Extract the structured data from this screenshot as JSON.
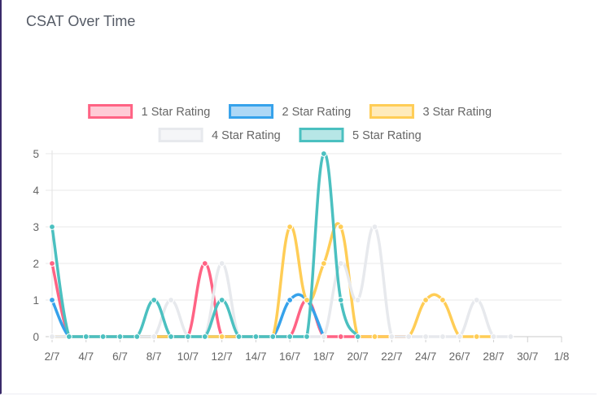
{
  "card": {
    "title": "CSAT Over Time"
  },
  "chart_data": {
    "type": "line",
    "title": "CSAT Over Time",
    "xlabel": "",
    "ylabel": "",
    "ylim": [
      0,
      5
    ],
    "grid": true,
    "legend_position": "top",
    "x": [
      "2/7",
      "3/7",
      "4/7",
      "5/7",
      "6/7",
      "7/7",
      "8/7",
      "9/7",
      "10/7",
      "11/7",
      "12/7",
      "13/7",
      "14/7",
      "15/7",
      "16/7",
      "17/7",
      "18/7",
      "19/7",
      "20/7",
      "21/7",
      "22/7",
      "23/7",
      "24/7",
      "25/7",
      "26/7",
      "27/7",
      "28/7",
      "29/7",
      "30/7",
      "31/7",
      "1/8"
    ],
    "x_tick_labels": [
      "2/7",
      "4/7",
      "6/7",
      "8/7",
      "10/7",
      "12/7",
      "14/7",
      "16/7",
      "18/7",
      "20/7",
      "22/7",
      "24/7",
      "26/7",
      "28/7",
      "30/7",
      "1/8"
    ],
    "y_ticks": [
      "0",
      "1",
      "2",
      "3",
      "4",
      "5"
    ],
    "series": [
      {
        "name": "1 Star Rating",
        "color": "#ff6384",
        "fill": "#ffcbd6",
        "values": [
          2,
          0,
          0,
          0,
          0,
          0,
          0,
          0,
          0,
          2,
          0,
          0,
          0,
          0,
          0,
          1,
          0,
          0,
          0,
          0,
          0,
          0,
          null,
          null,
          null,
          null,
          null,
          null,
          null,
          null,
          null
        ]
      },
      {
        "name": "2 Star Rating",
        "color": "#36a2eb",
        "fill": "#aed8f6",
        "values": [
          1,
          0,
          0,
          0,
          0,
          0,
          0,
          0,
          0,
          0,
          0,
          0,
          0,
          0,
          1,
          1,
          0,
          null,
          null,
          null,
          null,
          null,
          null,
          null,
          null,
          null,
          null,
          null,
          null,
          null,
          null
        ]
      },
      {
        "name": "3 Star Rating",
        "color": "#ffcd56",
        "fill": "#ffebbb",
        "values": [
          0,
          0,
          0,
          0,
          0,
          0,
          0,
          0,
          0,
          0,
          0,
          0,
          0,
          0,
          3,
          1,
          2,
          3,
          0,
          0,
          0,
          0,
          1,
          1,
          0,
          0,
          0,
          null,
          null,
          null,
          null
        ]
      },
      {
        "name": "4 Star Rating",
        "color": "#e7e9ed",
        "fill": "#f5f6f8",
        "values": [
          0,
          0,
          0,
          0,
          0,
          0,
          0,
          1,
          0,
          0,
          2,
          0,
          0,
          0,
          0,
          0,
          0,
          2,
          1,
          3,
          0,
          0,
          0,
          0,
          0,
          1,
          0,
          0,
          null,
          null,
          null
        ]
      },
      {
        "name": "5 Star Rating",
        "color": "#4bc0c0",
        "fill": "#b7e6e6",
        "values": [
          3,
          0,
          0,
          0,
          0,
          0,
          1,
          0,
          0,
          0,
          1,
          0,
          0,
          0,
          0,
          0,
          5,
          1,
          0,
          null,
          null,
          null,
          null,
          null,
          null,
          null,
          null,
          null,
          null,
          null,
          null
        ]
      }
    ]
  }
}
